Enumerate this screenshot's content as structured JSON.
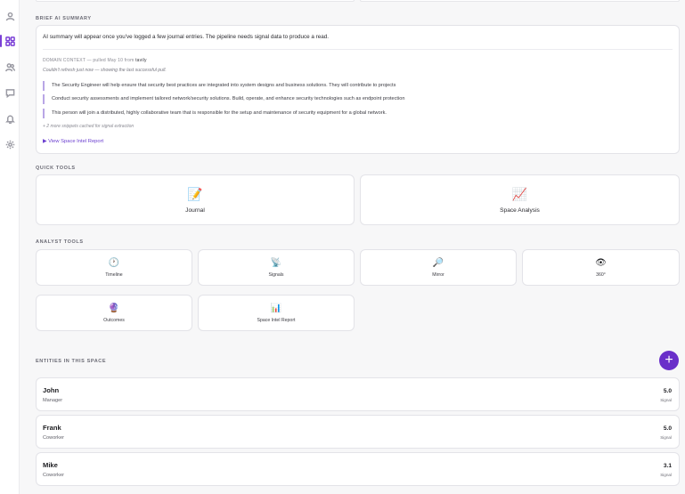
{
  "sidebar": {
    "icons": [
      "user-icon",
      "grid-icon",
      "users-icon",
      "chat-icon",
      "bell-icon",
      "settings-icon"
    ]
  },
  "summary": {
    "section_title": "BRIEF AI SUMMARY",
    "lead": "AI summary will appear once you've logged a few journal entries. The pipeline needs signal data to produce a read.",
    "context_label": "DOMAIN CONTEXT — pulled May 10 from",
    "context_source": "tavily",
    "context_note": "Couldn't refresh just now — showing the last successful pull.",
    "snippets": [
      "The Security Engineer will help ensure that security best practices are integrated into system designs and business solutions. They will contribute to projects",
      "Conduct security assessments and implement tailored network/security solutions. Build, operate, and enhance security technologies such as endpoint protection",
      "This person will join a distributed, highly collaborative team that is responsible for the setup and maintenance of security equipment for a global network."
    ],
    "more_note": "+ 2 more snippets cached for signal extraction",
    "view_link": "▶ View Space Intel Report"
  },
  "quick_tools": {
    "section_title": "QUICK TOOLS",
    "items": [
      {
        "label": "Journal",
        "emoji": "📝"
      },
      {
        "label": "Space Analysis",
        "emoji": "📈"
      }
    ]
  },
  "analyst_tools": {
    "section_title": "ANALYST TOOLS",
    "items": [
      {
        "label": "Timeline",
        "emoji": "🕐"
      },
      {
        "label": "Signals",
        "emoji": "📡"
      },
      {
        "label": "Mirror",
        "emoji": "🔎"
      },
      {
        "label": "360°",
        "emoji": "👁"
      },
      {
        "label": "Outcomes",
        "emoji": "🔮"
      },
      {
        "label": "Space Intel Report",
        "emoji": "📊"
      }
    ]
  },
  "entities": {
    "section_title": "ENTITIES IN THIS SPACE",
    "add_label": "+",
    "items": [
      {
        "name": "John",
        "role": "Manager",
        "score": "5.0",
        "score_label": "Signal"
      },
      {
        "name": "Frank",
        "role": "Coworker",
        "score": "5.0",
        "score_label": "Signal"
      },
      {
        "name": "Mike",
        "role": "Coworker",
        "score": "3.1",
        "score_label": "Signal"
      }
    ]
  },
  "colors": {
    "accent": "#6a2fc9",
    "link": "#6b3fd0",
    "snippet_border": "#b9a6e6"
  }
}
